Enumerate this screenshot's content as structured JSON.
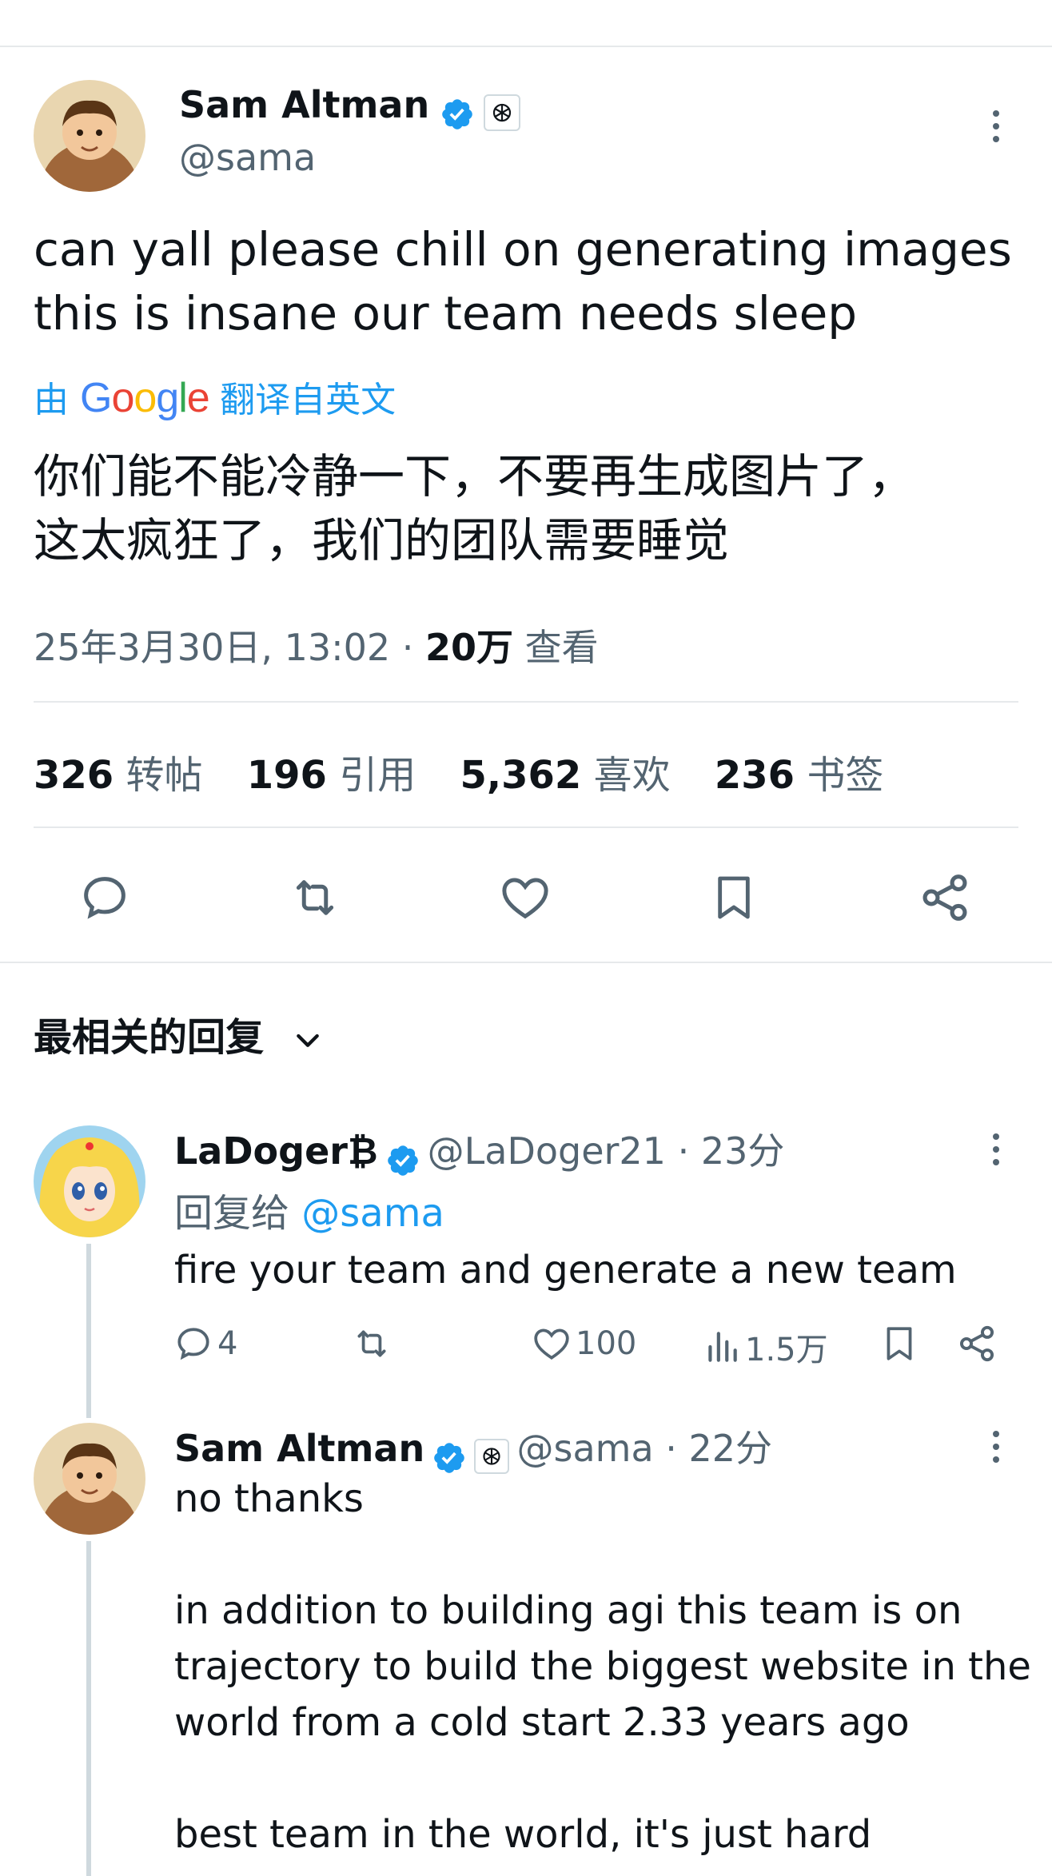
{
  "tweet": {
    "author_name": "Sam Altman",
    "author_handle": "@sama",
    "text": "can yall please chill on generating images\nthis is insane our team needs sleep",
    "translate_prefix": "由",
    "translate_provider": "Google",
    "translate_suffix": "翻译自英文",
    "translated_text": "你们能不能冷静一下，不要再生成图片了，\n这太疯狂了，我们的团队需要睡觉",
    "timestamp": "25年3月30日, 13:02 · ",
    "views_count": "20万",
    "views_label": " 查看",
    "stats": [
      {
        "num": "326",
        "label": "转帖"
      },
      {
        "num": "196",
        "label": "引用"
      },
      {
        "num": "5,362",
        "label": "喜欢"
      },
      {
        "num": "236",
        "label": "书签"
      }
    ],
    "actions": [
      "reply-icon",
      "retweet-icon",
      "like-icon",
      "bookmark-icon",
      "share-icon"
    ]
  },
  "replies_sort": {
    "label": "最相关的回复"
  },
  "reply1": {
    "author_name": "LaDoger₿",
    "author_handle": "@LaDoger21 · 23分",
    "replying_prefix": "回复给 ",
    "replying_mention": "@sama",
    "text": "fire your team and generate a new team",
    "reply_count": "4",
    "like_count": "100",
    "view_count": "1.5万"
  },
  "reply2": {
    "author_name": "Sam Altman",
    "author_handle": "@sama · 22分",
    "text": "no thanks\n\nin addition to building agi this team is on\ntrajectory to build the biggest website in the\nworld from a cold start 2.33 years ago\n\nbest team in the world, it's just hard"
  },
  "colors": {
    "accent": "#1d9bf0",
    "secondary_text": "#536471",
    "divider": "#e6e9eb"
  }
}
